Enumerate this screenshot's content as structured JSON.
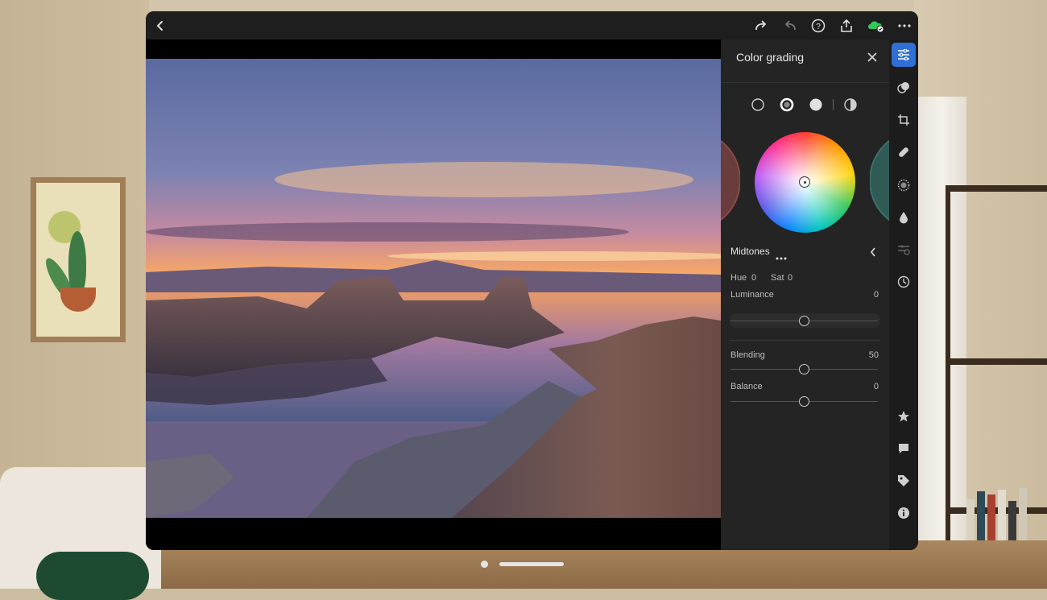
{
  "panel": {
    "title": "Color grading",
    "modes": [
      "shadows",
      "midtones",
      "highlights",
      "global"
    ],
    "region_label": "Midtones",
    "hue_label": "Hue",
    "hue_value": "0",
    "sat_label": "Sat",
    "sat_value": "0",
    "luminance_label": "Luminance",
    "luminance_value": "0",
    "luminance_level": 0.5,
    "blending_label": "Blending",
    "blending_value": "50",
    "blending_level": 0.5,
    "balance_label": "Balance",
    "balance_value": "0",
    "balance_level": 0.5
  },
  "topbar": {
    "icons": [
      "back-icon",
      "redo-icon",
      "undo-icon",
      "help-icon",
      "share-icon",
      "cloud-sync-icon",
      "more-icon"
    ]
  },
  "tools": [
    "edit-sliders-icon",
    "masking-icon",
    "crop-icon",
    "healing-icon",
    "presets-icon",
    "color-drop-icon",
    "versions-icon",
    "history-icon",
    "star-icon",
    "comment-icon",
    "tag-icon",
    "info-icon"
  ],
  "colors": {
    "accent": "#2f6fd6",
    "sync": "#34c759"
  }
}
